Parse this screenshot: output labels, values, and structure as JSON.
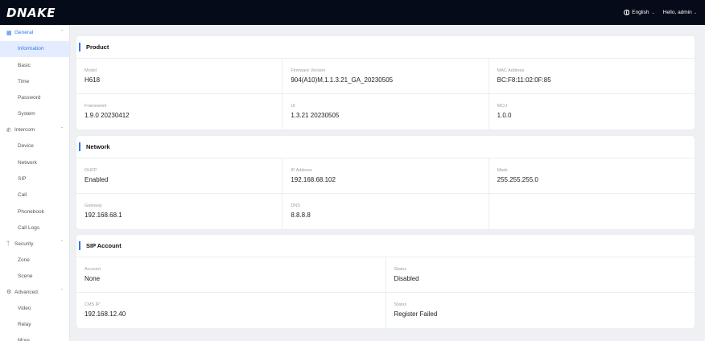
{
  "brand": {
    "logo": "DNAKE"
  },
  "header": {
    "language": "English",
    "user": "Hello, admin"
  },
  "sidebar": {
    "general": {
      "label": "General",
      "items": [
        "Information",
        "Basic",
        "Time",
        "Password",
        "System"
      ]
    },
    "intercom": {
      "label": "Intercom",
      "items": [
        "Device",
        "Network",
        "SIP",
        "Call",
        "Phonebook",
        "Call Logs"
      ]
    },
    "security": {
      "label": "Security",
      "items": [
        "Zone",
        "Scene"
      ]
    },
    "advanced": {
      "label": "Advanced",
      "items": [
        "Video",
        "Relay",
        "More"
      ]
    }
  },
  "product": {
    "title": "Product",
    "model_label": "Model",
    "model": "H618",
    "firmware_label": "Firmware Version",
    "firmware": "904(A10)M.1.1.3.21_GA_20230505",
    "mac_label": "MAC Address",
    "mac": "BC:F8:11:02:0F:85",
    "framework_label": "Framework",
    "framework": "1.9.0 20230412",
    "ui_label": "UI",
    "ui": "1.3.21 20230505",
    "mcu_label": "MCU",
    "mcu": "1.0.0"
  },
  "network": {
    "title": "Network",
    "dhcp_label": "DHCP",
    "dhcp": "Enabled",
    "ip_label": "IP Address",
    "ip": "192.168.68.102",
    "mask_label": "Mask",
    "mask": "255.255.255.0",
    "gateway_label": "Gateway",
    "gateway": "192.168.68.1",
    "dns_label": "DNS",
    "dns": "8.8.8.8"
  },
  "sip": {
    "title": "SIP Account",
    "account_label": "Account",
    "account": "None",
    "status_label": "Status",
    "status": "Disabled",
    "cms_label": "CMS IP",
    "cms": "192.168.12.40",
    "status2_label": "Status",
    "status2": "Register Failed"
  },
  "colors": {
    "accent": "#2e76f0",
    "topbar": "#050b18",
    "background": "#eef0f4"
  }
}
